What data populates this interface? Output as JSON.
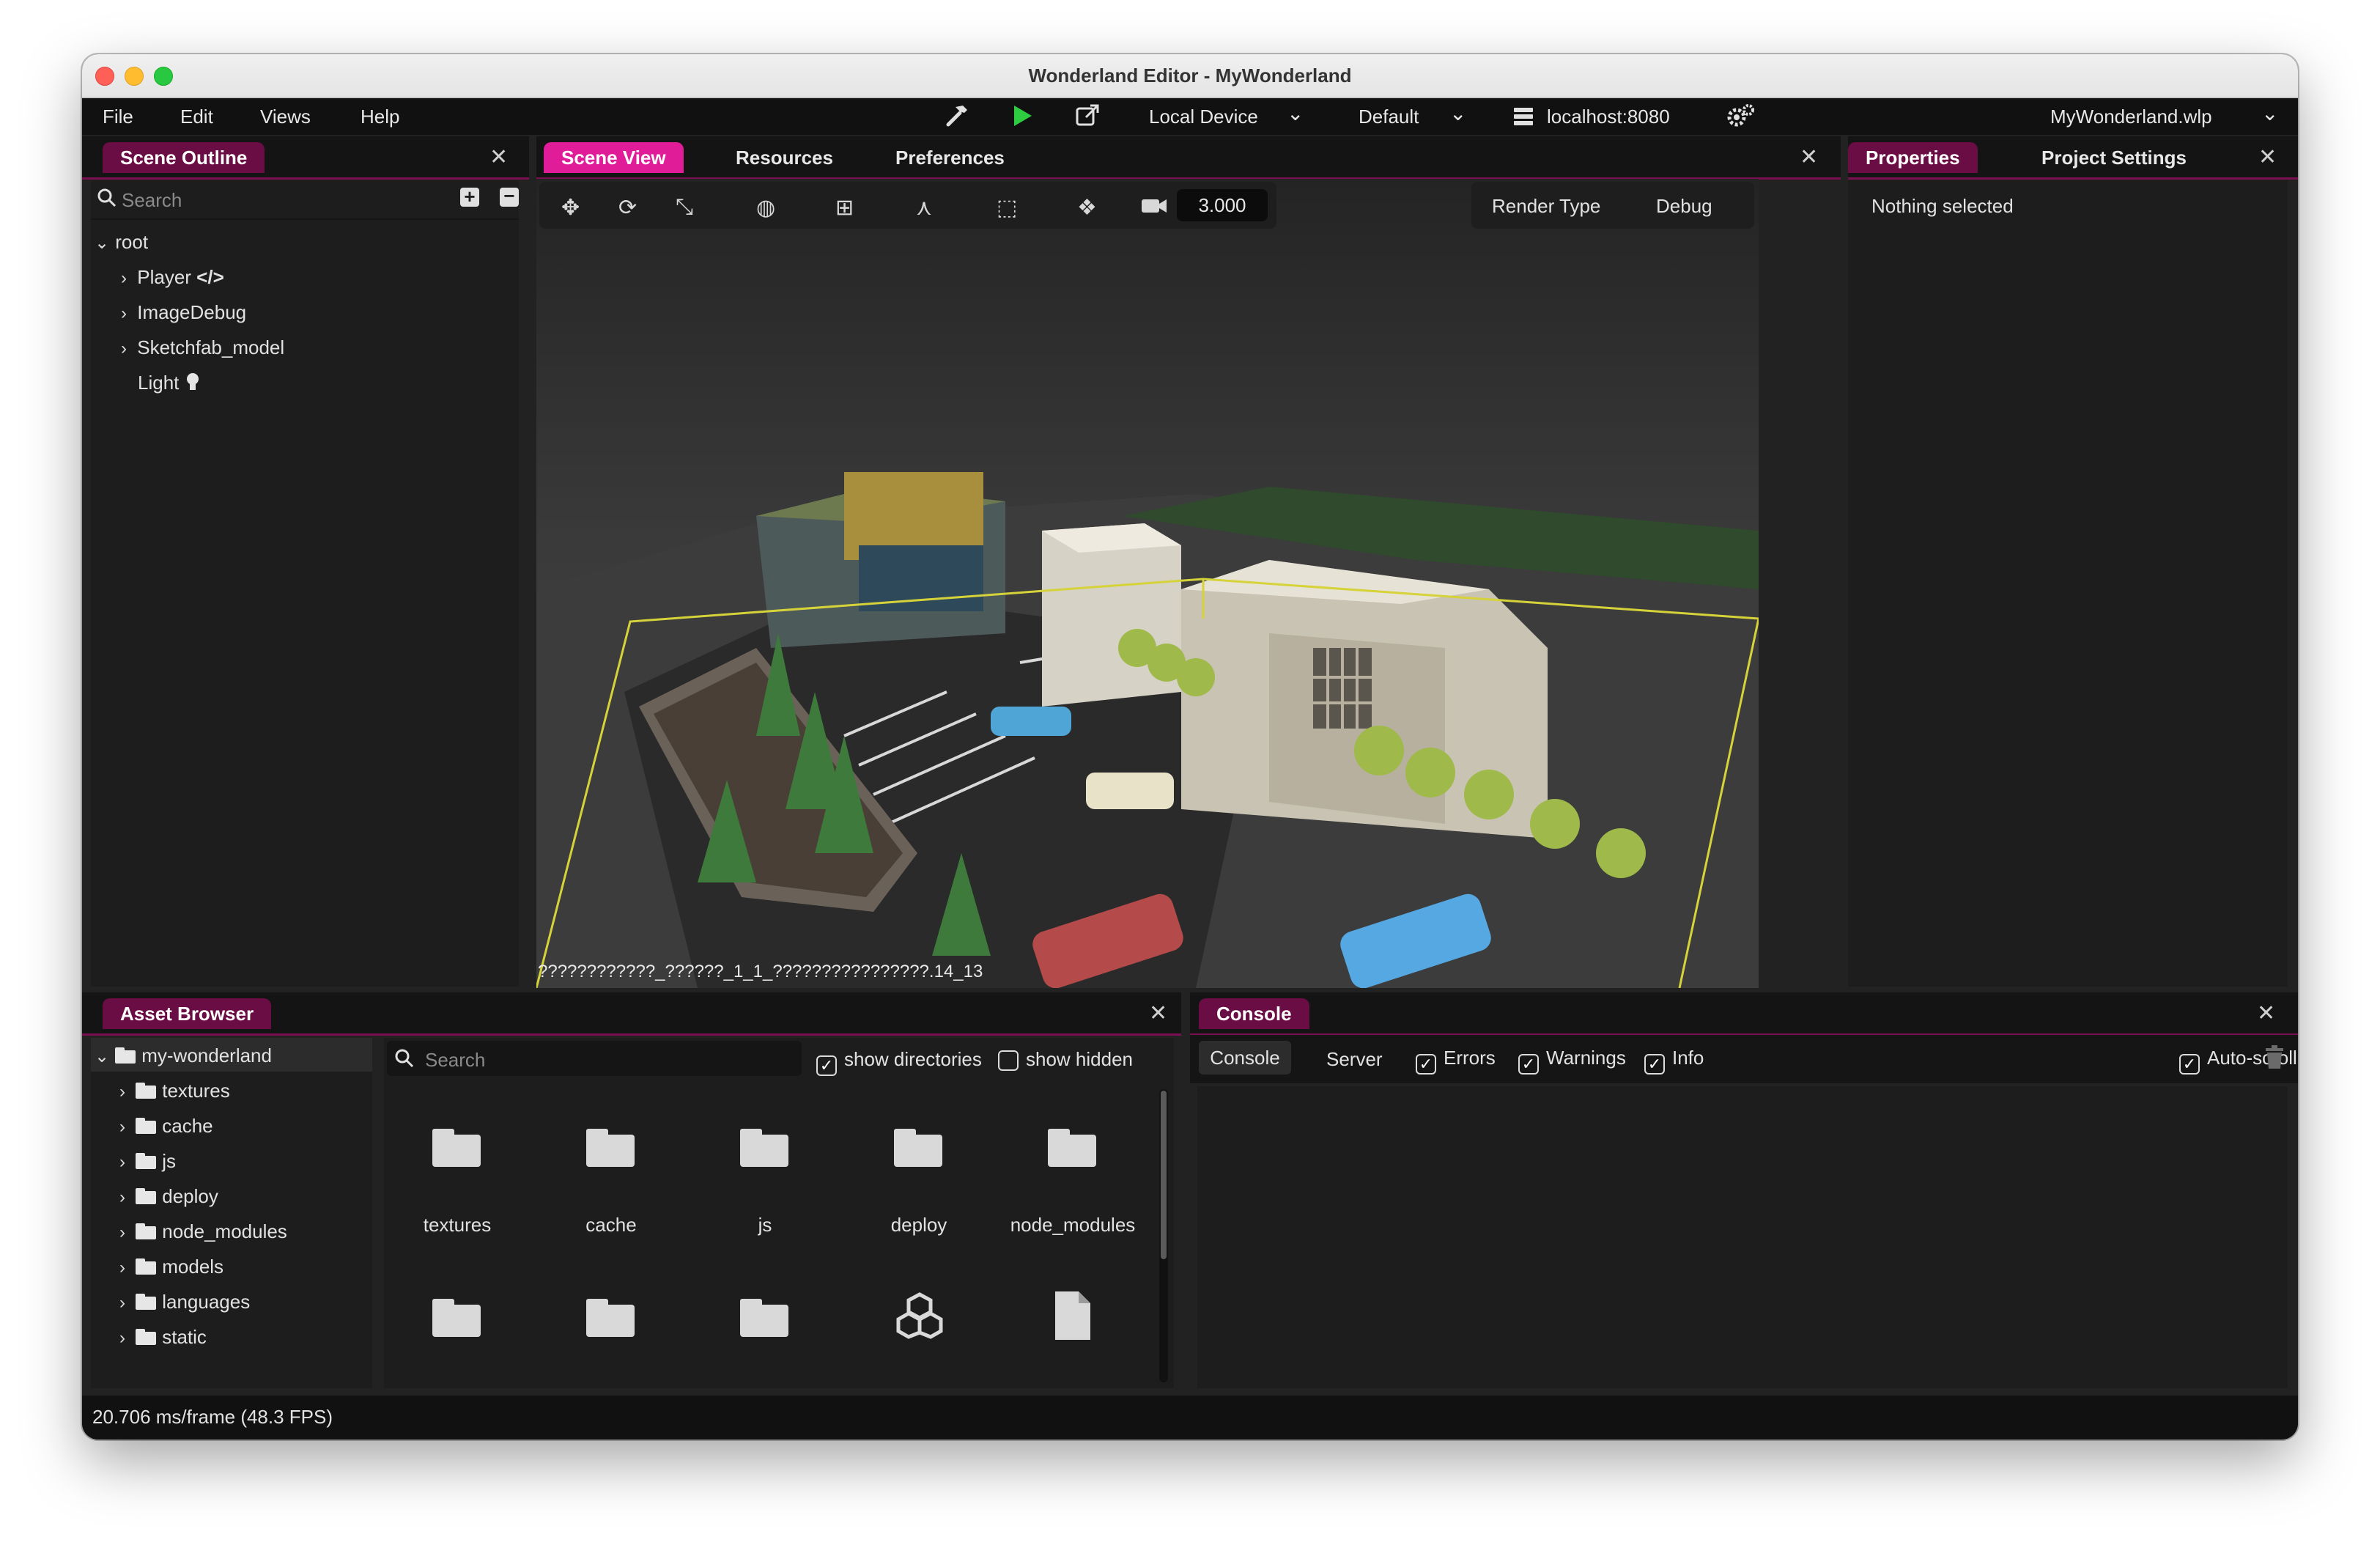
{
  "window": {
    "title": "Wonderland Editor - MyWonderland"
  },
  "menu": {
    "file": "File",
    "edit": "Edit",
    "views": "Views",
    "help": "Help",
    "device": "Local Device",
    "profile": "Default",
    "server": "localhost:8080",
    "project_file": "MyWonderland.wlp"
  },
  "scene_outline": {
    "tab": "Scene Outline",
    "search_placeholder": "Search",
    "items": [
      {
        "label": "root"
      },
      {
        "label": "Player"
      },
      {
        "label": "ImageDebug"
      },
      {
        "label": "Sketchfab_model"
      },
      {
        "label": "Light"
      }
    ]
  },
  "center": {
    "tabs": [
      "Scene View",
      "Resources",
      "Preferences"
    ],
    "zoom_value": "3.000",
    "render_type": "Render Type",
    "debug": "Debug",
    "overlay_text": "????????????_??????_1_1_????????????????.14_13"
  },
  "properties": {
    "tabs": [
      "Properties",
      "Project Settings"
    ],
    "empty_text": "Nothing selected"
  },
  "asset_browser": {
    "tab": "Asset Browser",
    "tree_root": "my-wonderland",
    "tree": [
      "textures",
      "cache",
      "js",
      "deploy",
      "node_modules",
      "models",
      "languages",
      "static"
    ],
    "search_placeholder": "Search",
    "show_directories": "show directories",
    "show_hidden": "show hidden",
    "grid_labels": [
      "textures",
      "cache",
      "js",
      "deploy",
      "node_modules"
    ]
  },
  "console": {
    "tab": "Console",
    "console_btn": "Console",
    "server_btn": "Server",
    "errors": "Errors",
    "warnings": "Warnings",
    "info": "Info",
    "autoscroll": "Auto-scroll"
  },
  "status": {
    "fps": "20.706 ms/frame (48.3 FPS)"
  },
  "colors": {
    "accent_pink": "#e01c98",
    "accent_dark": "#6a0d44",
    "play_green": "#2ecc40"
  }
}
